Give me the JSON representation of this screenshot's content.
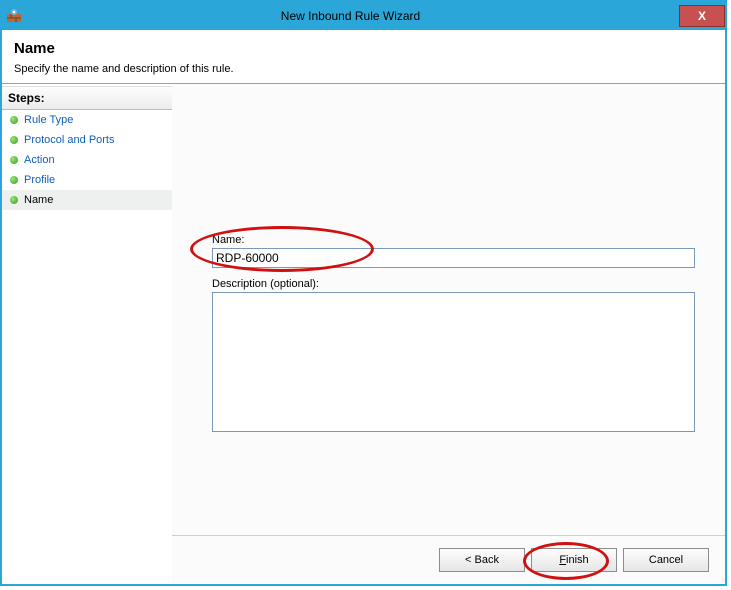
{
  "window": {
    "title": "New Inbound Rule Wizard",
    "close_glyph": "X"
  },
  "header": {
    "title": "Name",
    "subtitle": "Specify the name and description of this rule."
  },
  "sidebar": {
    "heading": "Steps:",
    "items": [
      {
        "label": "Rule Type",
        "current": false
      },
      {
        "label": "Protocol and Ports",
        "current": false
      },
      {
        "label": "Action",
        "current": false
      },
      {
        "label": "Profile",
        "current": false
      },
      {
        "label": "Name",
        "current": true
      }
    ]
  },
  "form": {
    "name_label": "Name:",
    "name_value": "RDP-60000",
    "description_label": "Description (optional):",
    "description_value": ""
  },
  "buttons": {
    "back": "< Back",
    "finish_prefix": "F",
    "finish_rest": "inish",
    "cancel": "Cancel"
  }
}
